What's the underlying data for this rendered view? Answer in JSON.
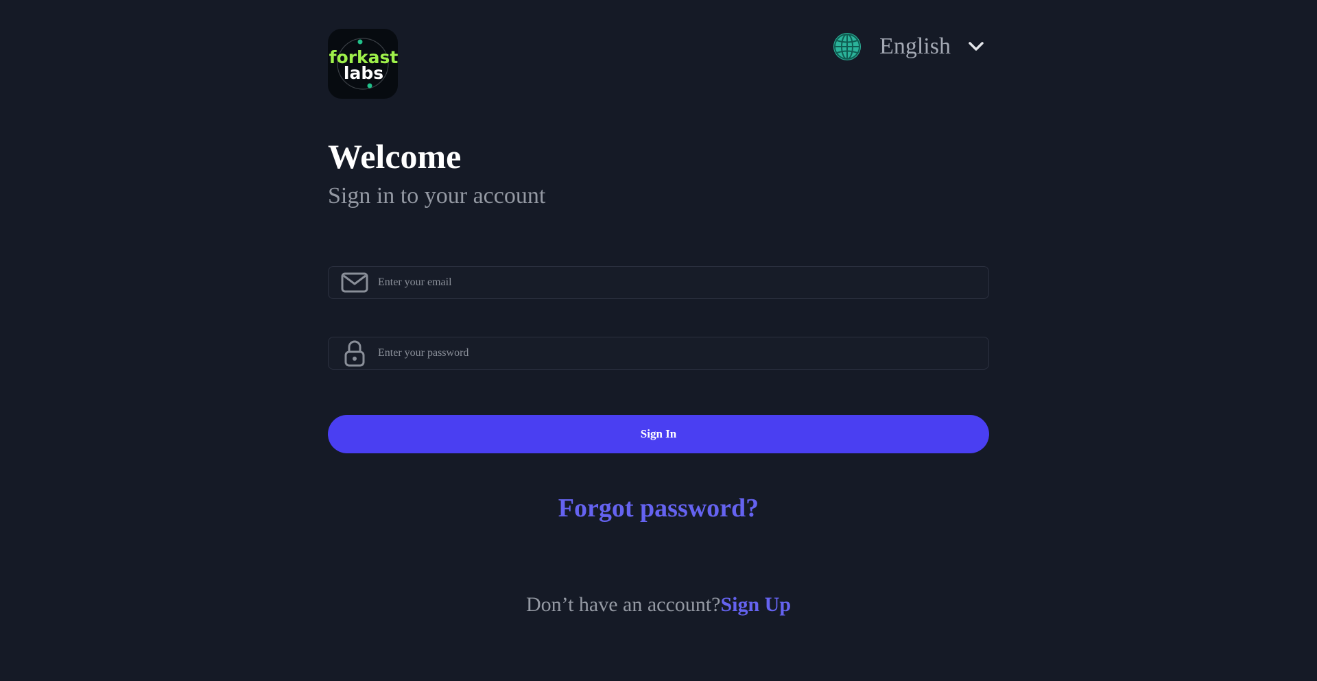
{
  "header": {
    "logo": {
      "top_text": "forkast",
      "bottom_text": "labs",
      "icon": "forkast-labs-logo"
    },
    "language": {
      "icon": "globe-icon",
      "selected": "English",
      "chevron_icon": "chevron-down-icon"
    }
  },
  "main": {
    "title": "Welcome",
    "subtitle": "Sign in to your account"
  },
  "form": {
    "email": {
      "icon": "mail-icon",
      "placeholder": "Enter your email",
      "value": ""
    },
    "password": {
      "icon": "lock-icon",
      "placeholder": "Enter your password",
      "value": ""
    },
    "submit_label": "Sign In",
    "forgot_label": "Forgot password?"
  },
  "footer": {
    "prompt": "Don’t have an account?",
    "signup_label": "Sign Up"
  },
  "colors": {
    "background": "#151a26",
    "primary": "#4a3ff2",
    "link": "#6563f0",
    "logo_accent": "#9ef04a",
    "globe": "#2bb39a"
  }
}
